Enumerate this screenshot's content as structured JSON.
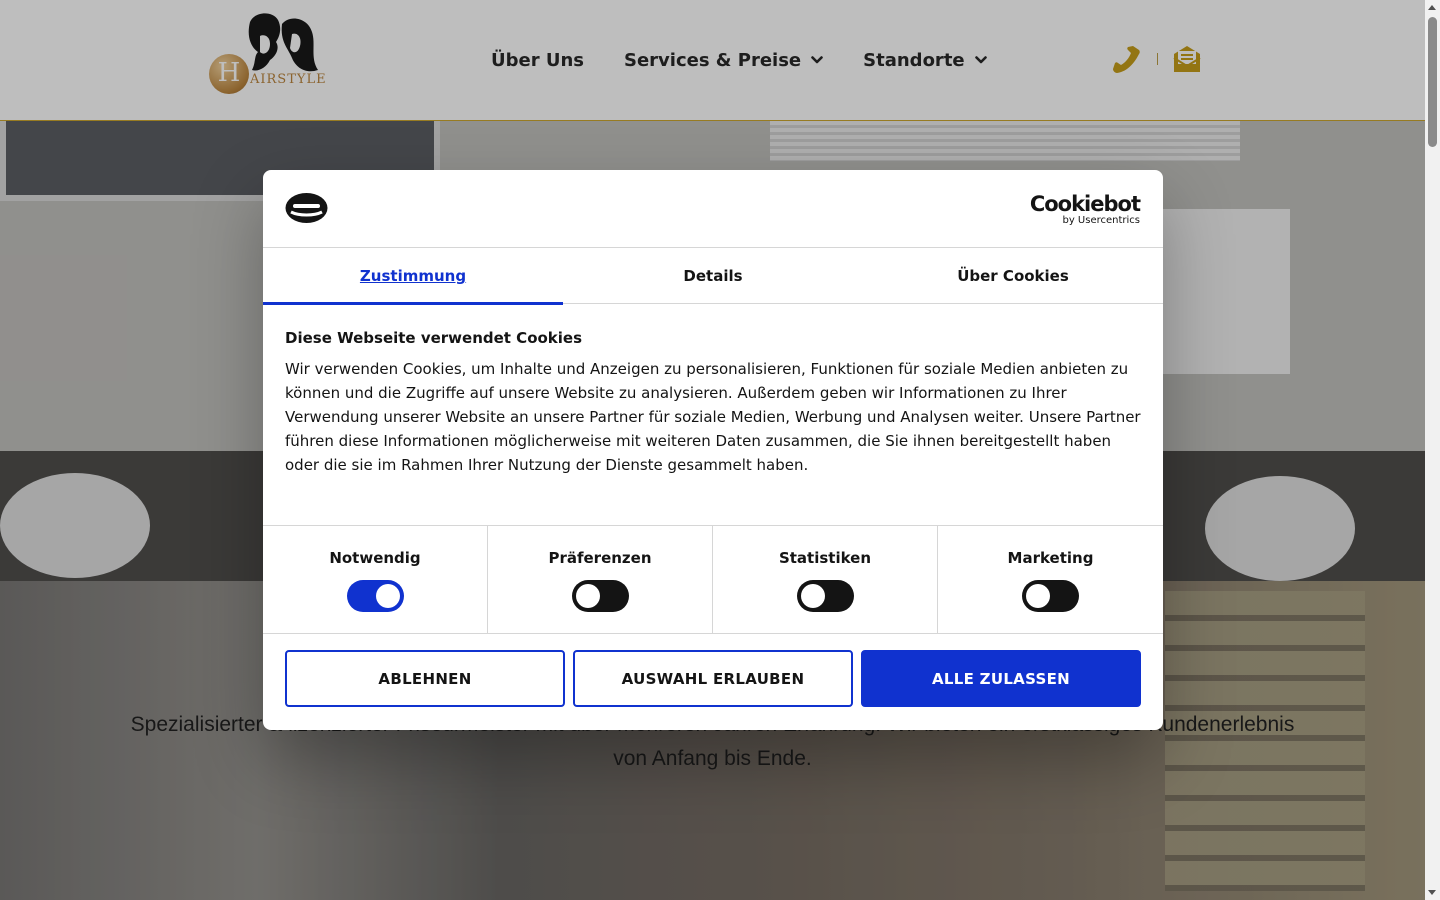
{
  "header": {
    "logo_text": "AIRSTYLE",
    "logo_letter": "H",
    "nav": [
      {
        "label": "Über Uns"
      },
      {
        "label": "Services & Preise"
      },
      {
        "label": "Standorte"
      }
    ],
    "icons": {
      "phone": "phone-icon",
      "mail": "envelope-icon"
    },
    "accent_color": "#c9a227"
  },
  "hero": {
    "text_line1": "Spezialisierter & lizenzierter Friseurmeister mit über mehreren Jahren Erfahrung. Wir bieten ein erstklassiges Kundenerlebnis",
    "text_line2": "von Anfang bis Ende."
  },
  "cookie_dialog": {
    "brand": "Cookiebot",
    "brand_sub": "by Usercentrics",
    "tabs": [
      {
        "label": "Zustimmung",
        "active": true
      },
      {
        "label": "Details",
        "active": false
      },
      {
        "label": "Über Cookies",
        "active": false
      }
    ],
    "title": "Diese Webseite verwendet Cookies",
    "body": "Wir verwenden Cookies, um Inhalte und Anzeigen zu personalisieren, Funktionen für soziale Medien anbieten zu können und die Zugriffe auf unsere Website zu analysieren. Außerdem geben wir Informationen zu Ihrer Verwendung unserer Website an unsere Partner für soziale Medien, Werbung und Analysen weiter. Unsere Partner führen diese Informationen möglicherweise mit weiteren Daten zusammen, die Sie ihnen bereitgestellt haben oder die sie im Rahmen Ihrer Nutzung der Dienste gesammelt haben.",
    "toggles": [
      {
        "label": "Notwendig",
        "on": true
      },
      {
        "label": "Präferenzen",
        "on": false
      },
      {
        "label": "Statistiken",
        "on": false
      },
      {
        "label": "Marketing",
        "on": false
      }
    ],
    "buttons": {
      "decline": "ABLEHNEN",
      "allow_selection": "AUSWAHL ERLAUBEN",
      "allow_all": "ALLE ZULASSEN"
    },
    "primary_color": "#1032cf"
  }
}
